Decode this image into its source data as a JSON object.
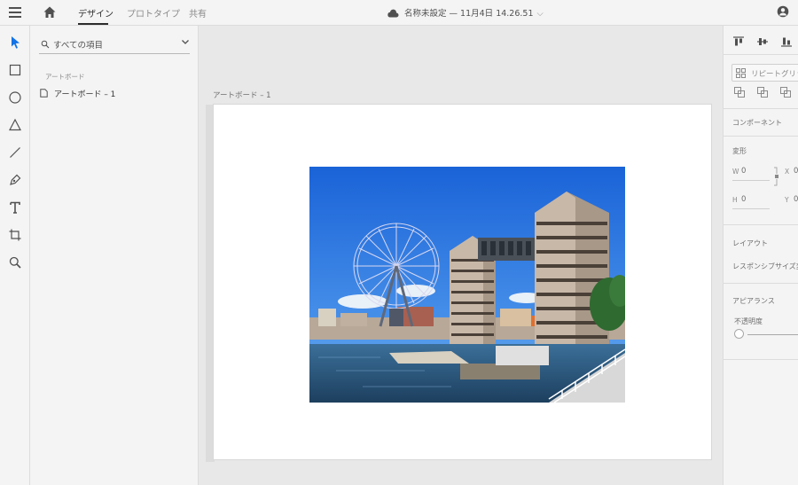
{
  "topbar": {
    "tabs": [
      {
        "label": "デザイン",
        "active": true
      },
      {
        "label": "プロトタイプ",
        "active": false
      },
      {
        "label": "共有",
        "active": false
      }
    ],
    "document_title": "名称未設定 — 11月4日 14.26.51"
  },
  "toolbar": {
    "tools": [
      "select-tool",
      "rectangle-tool",
      "ellipse-tool",
      "polygon-tool",
      "line-tool",
      "pen-tool",
      "text-tool",
      "artboard-tool",
      "zoom-tool"
    ]
  },
  "layers": {
    "search_filter": "すべての項目",
    "section_label": "アートボード",
    "items": [
      {
        "label": "アートボード – 1"
      }
    ]
  },
  "canvas": {
    "artboard_label": "アートボード – 1",
    "photo_description_icon": "ferris-wheel-photo"
  },
  "properties": {
    "repeat_grid_label": "リピートグリッド",
    "component_label": "コンポーネント",
    "transform_label": "変形",
    "w_label": "W",
    "w_value": "0",
    "x_label": "X",
    "x_value": "0",
    "h_label": "H",
    "h_value": "0",
    "y_label": "Y",
    "y_value": "0",
    "layout_label": "レイアウト",
    "responsive_label": "レスポンシブサイズ変更",
    "appearance_label": "アピアランス",
    "opacity_label": "不透明度"
  },
  "colors": {
    "accent": "#1473e6",
    "sky": "#1e6fe0",
    "water": "#2e5d86"
  }
}
